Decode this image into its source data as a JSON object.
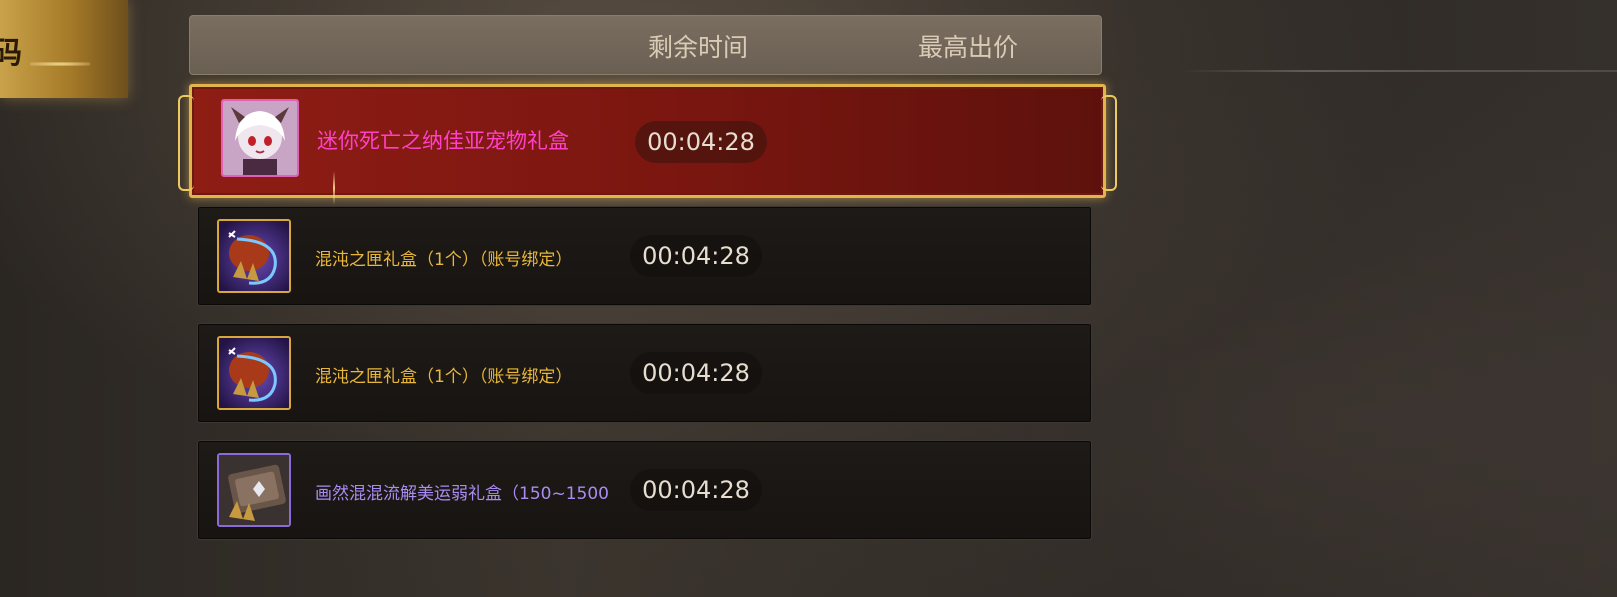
{
  "left_tab": {
    "label": "码"
  },
  "header": {
    "col_time": "剩余时间",
    "col_bid": "最高出价"
  },
  "auction_items": [
    {
      "name": "迷你死亡之纳佳亚宠物礼盒",
      "time_left": "00:04:28",
      "icon": "mini-pet-chibi-icon",
      "name_color": "#ff40c8",
      "selected": true
    },
    {
      "name": "混沌之匣礼盒（1个）（账号绑定）",
      "time_left": "00:04:28",
      "icon": "chaos-box-icon",
      "name_color": "#e9b83a",
      "selected": false
    },
    {
      "name": "混沌之匣礼盒（1个）（账号绑定）",
      "time_left": "00:04:28",
      "icon": "chaos-box-icon",
      "name_color": "#e9b83a",
      "selected": false
    },
    {
      "name": "画然混混流解美运弱礼盒（150~1500",
      "time_left": "00:04:28",
      "icon": "gift-card-icon",
      "name_color": "#a98cf0",
      "selected": false
    }
  ]
}
